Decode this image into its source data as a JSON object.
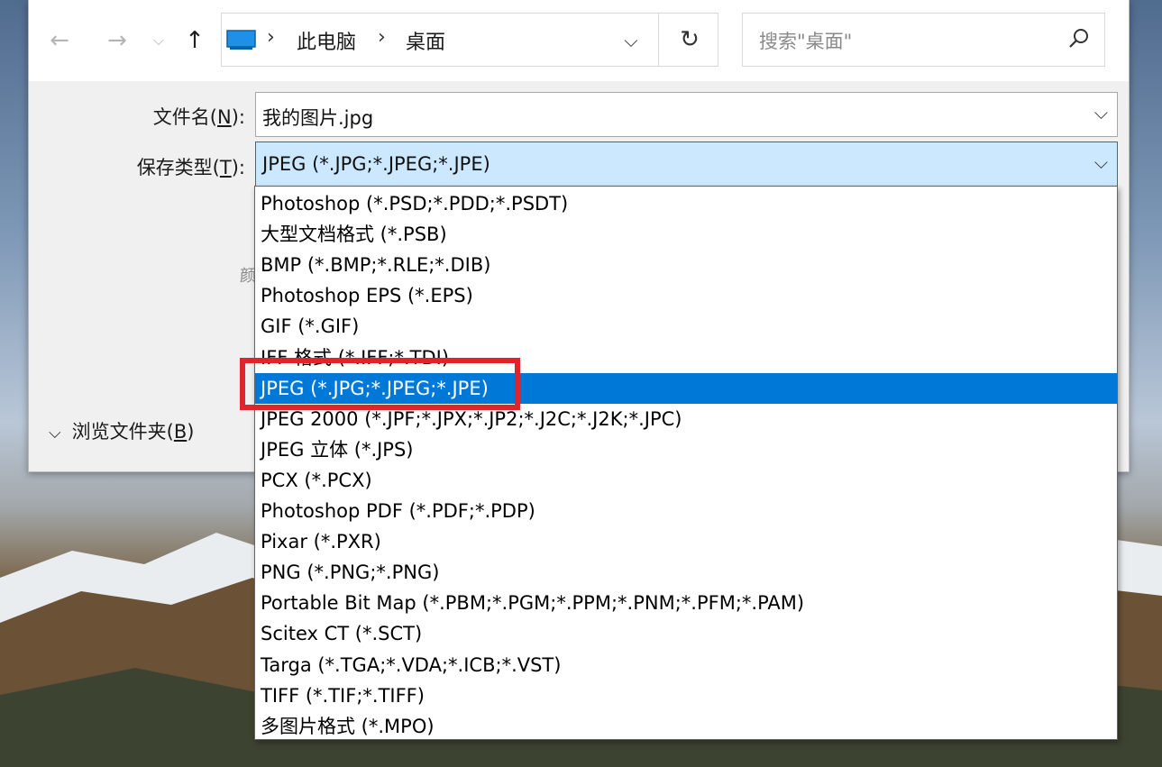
{
  "nav": {
    "back_icon": "arrow-left-icon",
    "forward_icon": "arrow-right-icon",
    "recent_icon": "chevron-down-icon",
    "up_icon": "arrow-up-icon"
  },
  "address": {
    "crumbs": [
      "此电脑",
      "桌面"
    ],
    "separator": "›",
    "dropdown_glyph": "⌵",
    "refresh_glyph": "↻"
  },
  "search": {
    "placeholder": "搜索\"桌面\""
  },
  "filename": {
    "label": "文件名(",
    "accel": "N",
    "label_end": "):",
    "value": "我的图片.jpg"
  },
  "filetype": {
    "label": "保存类型(",
    "accel": "T",
    "label_end": "):",
    "value": "JPEG (*.JPG;*.JPEG;*.JPE)"
  },
  "browse": {
    "label": "浏览文件夹(",
    "accel": "B",
    "label_end": ")"
  },
  "partial_text": "颜",
  "dropdown": {
    "selected_index": 6,
    "options": [
      "Photoshop (*.PSD;*.PDD;*.PSDT)",
      "大型文档格式 (*.PSB)",
      "BMP (*.BMP;*.RLE;*.DIB)",
      "Photoshop EPS (*.EPS)",
      "GIF (*.GIF)",
      "IFF 格式 (*.IFF;*.TDI)",
      "JPEG (*.JPG;*.JPEG;*.JPE)",
      "JPEG 2000 (*.JPF;*.JPX;*.JP2;*.J2C;*.J2K;*.JPC)",
      "JPEG 立体 (*.JPS)",
      "PCX (*.PCX)",
      "Photoshop PDF (*.PDF;*.PDP)",
      "Pixar (*.PXR)",
      "PNG (*.PNG;*.PNG)",
      "Portable Bit Map (*.PBM;*.PGM;*.PPM;*.PNM;*.PFM;*.PAM)",
      "Scitex CT (*.SCT)",
      "Targa (*.TGA;*.VDA;*.ICB;*.VST)",
      "TIFF (*.TIF;*.TIFF)",
      "多图片格式 (*.MPO)"
    ]
  },
  "colors": {
    "highlight": "#0078d7",
    "selected_field": "#cce8ff",
    "annotation": "#e0242c"
  }
}
